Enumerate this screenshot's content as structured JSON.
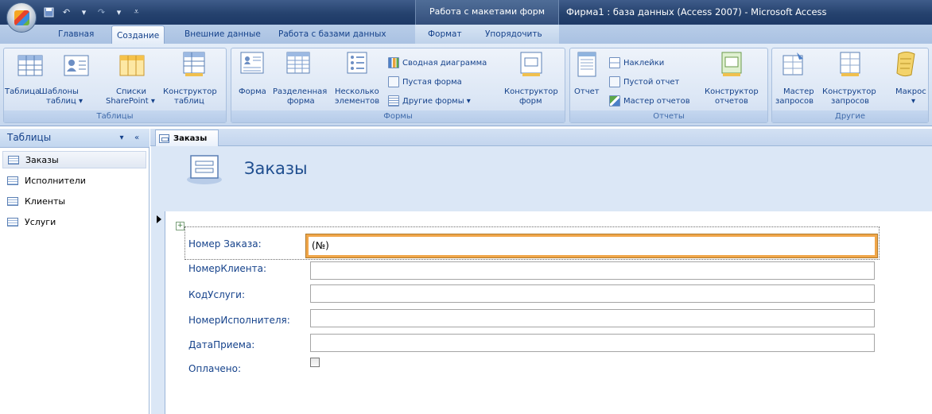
{
  "window": {
    "title": "Фирма1 : база данных (Access 2007) - Microsoft Access",
    "context_tab_title": "Работа с макетами форм"
  },
  "ribbon_tabs": [
    "Главная",
    "Создание",
    "Внешние данные",
    "Работа с базами данных",
    "Формат",
    "Упорядочить"
  ],
  "active_tab": "Создание",
  "ribbon": {
    "tables": {
      "label": "Таблицы",
      "table": "Таблица",
      "templates_1": "Шаблоны",
      "templates_2": "таблиц ▾",
      "lists_1": "Списки",
      "lists_2": "SharePoint ▾",
      "designer_1": "Конструктор",
      "designer_2": "таблиц"
    },
    "forms": {
      "label": "Формы",
      "form": "Форма",
      "split_1": "Разделенная",
      "split_2": "форма",
      "multi_1": "Несколько",
      "multi_2": "элементов",
      "pivot_chart": "Сводная диаграмма",
      "blank_form": "Пустая форма",
      "other_forms": "Другие формы ▾",
      "designer_1": "Конструктор",
      "designer_2": "форм"
    },
    "reports": {
      "label": "Отчеты",
      "report": "Отчет",
      "labels": "Наклейки",
      "blank_report": "Пустой отчет",
      "wizard": "Мастер отчетов",
      "designer_1": "Конструктор",
      "designer_2": "отчетов"
    },
    "other": {
      "label": "Другие",
      "query_wizard_1": "Мастер",
      "query_wizard_2": "запросов",
      "query_designer_1": "Конструктор",
      "query_designer_2": "запросов",
      "macro": "Макрос",
      "macro_arrow": "▾"
    }
  },
  "nav_pane": {
    "title": "Таблицы",
    "dropdown": "▾",
    "collapse": "«",
    "items": [
      {
        "label": "Заказы",
        "selected": true
      },
      {
        "label": "Исполнители",
        "selected": false
      },
      {
        "label": "Клиенты",
        "selected": false
      },
      {
        "label": "Услуги",
        "selected": false
      }
    ]
  },
  "document_tab": "Заказы",
  "form": {
    "title": "Заказы",
    "move_handle": "+",
    "fields": [
      {
        "label": "Номер Заказа:",
        "value": "(№)"
      },
      {
        "label": "НомерКлиента:",
        "value": ""
      },
      {
        "label": "КодУслуги:",
        "value": ""
      },
      {
        "label": "НомерИсполнителя:",
        "value": ""
      },
      {
        "label": "ДатаПриема:",
        "value": ""
      },
      {
        "label": "Оплачено:",
        "checked": false
      }
    ]
  },
  "colors": {
    "accent_border": "#f0a64a",
    "ribbon_text": "#15428b",
    "titlebar": "#25426e"
  }
}
